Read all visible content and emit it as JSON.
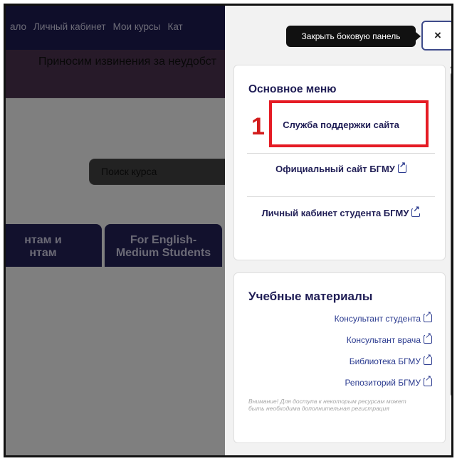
{
  "nav": {
    "items": [
      "ало",
      "Личный кабинет",
      "Мои курсы",
      "Кат"
    ]
  },
  "alert": {
    "text": "Приносим извинения за неудобст"
  },
  "search": {
    "placeholder": "Поиск курса"
  },
  "tiles": [
    {
      "line1": "нтам и",
      "line2": "нтам"
    },
    {
      "line1": "For English-",
      "line2": "Medium Students"
    }
  ],
  "drawer": {
    "close_label": "×",
    "tooltip": "Закрыть боковую панель",
    "main_menu": {
      "title": "Основное меню",
      "links": [
        "Служба поддержки сайта",
        "Официальный сайт БГМУ",
        "Личный кабинет студента БГМУ"
      ]
    },
    "materials": {
      "title": "Учебные материалы",
      "links": [
        "Консультант студента",
        "Консультант врача",
        "Библиотека БГМУ",
        "Репозиторий БГМУ"
      ],
      "note": "Внимание! Для доступа к некоторым ресурсам может быть необходима дополнительная регистрация"
    }
  },
  "annotation": {
    "number": "1"
  },
  "colors": {
    "brand": "#1f1d55",
    "highlight": "#e51b24",
    "link": "#2a3a8f"
  }
}
